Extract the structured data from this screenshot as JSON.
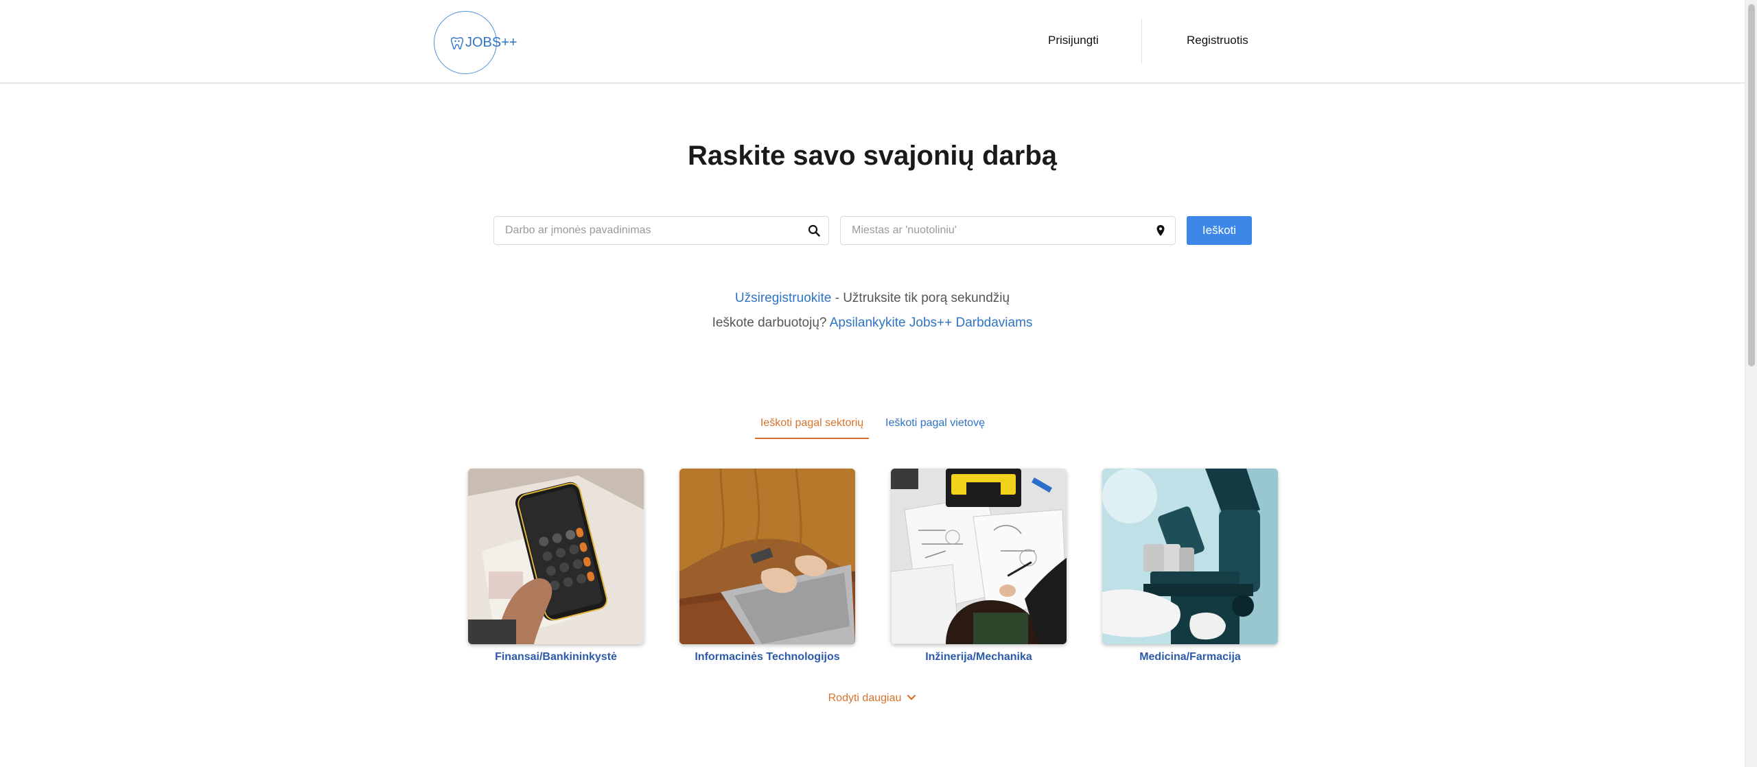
{
  "header": {
    "logo_text": "JOBS++",
    "login_label": "Prisijungti",
    "register_label": "Registruotis"
  },
  "hero": {
    "title": "Raskite savo svajonių darbą",
    "job_search_placeholder": "Darbo ar įmonės pavadinimas",
    "city_search_placeholder": "Miestas ar 'nuotoliniu'",
    "search_button": "Ieškoti"
  },
  "info": {
    "register_link": "Užsiregistruokite",
    "register_suffix": " - Užtruksite tik porą sekundžių",
    "employer_prefix": "Ieškote darbuotojų? ",
    "employer_link": "Apsilankykite Jobs++ Darbdaviams"
  },
  "tabs": [
    {
      "label": "Ieškoti pagal sektorių",
      "active": true
    },
    {
      "label": "Ieškoti pagal vietovę",
      "active": false
    }
  ],
  "sectors": [
    {
      "label": "Finansai/Bankininkystė",
      "image": "phone-calculator"
    },
    {
      "label": "Informacinės Technologijos",
      "image": "laptop-typing"
    },
    {
      "label": "Inžinerija/Mechanika",
      "image": "engineering-drawings"
    },
    {
      "label": "Medicina/Farmacija",
      "image": "microscope"
    }
  ],
  "show_more": "Rodyti daugiau",
  "colors": {
    "accent_blue": "#3d87e8",
    "link_blue": "#2f74c4",
    "accent_orange": "#d9722a"
  },
  "icons": {
    "search": "search-icon",
    "location": "map-pin-icon",
    "chevron": "chevron-down-icon"
  }
}
